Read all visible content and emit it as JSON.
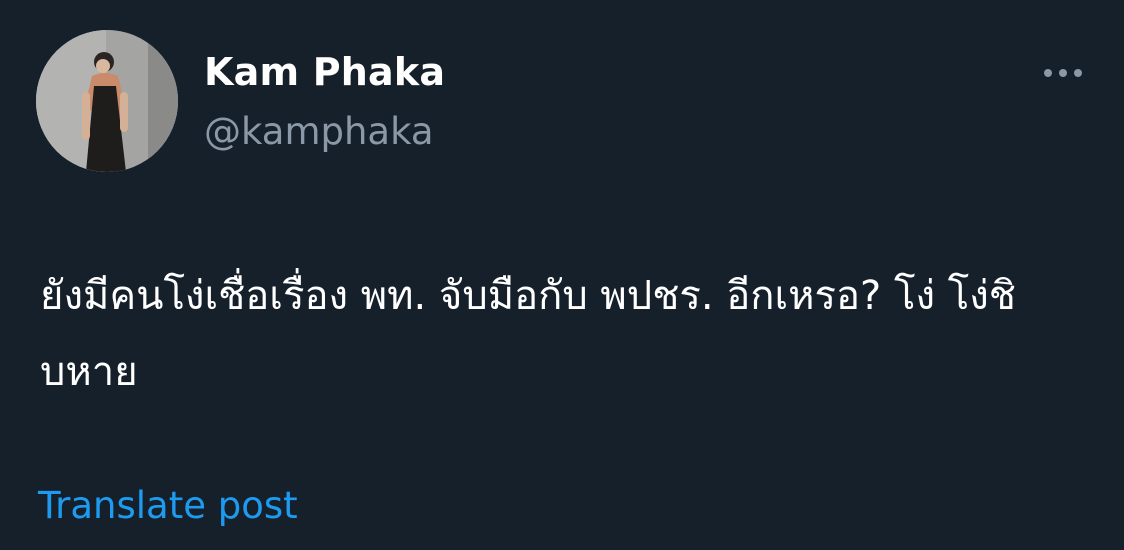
{
  "author": {
    "display_name": "Kam Phaka",
    "handle": "@kamphaka"
  },
  "tweet": {
    "text": "ยังมีคนโง่เชื่อเรื่อง พท. จับมือกับ พปชร. อีกเหรอ? โง่ โง่ชิบหาย"
  },
  "actions": {
    "translate_label": "Translate post",
    "more_icon": "more-horizontal-icon"
  },
  "colors": {
    "background": "#15202b",
    "primary_text": "#ffffff",
    "secondary_text": "#8b98a5",
    "link": "#1d9bf0"
  }
}
